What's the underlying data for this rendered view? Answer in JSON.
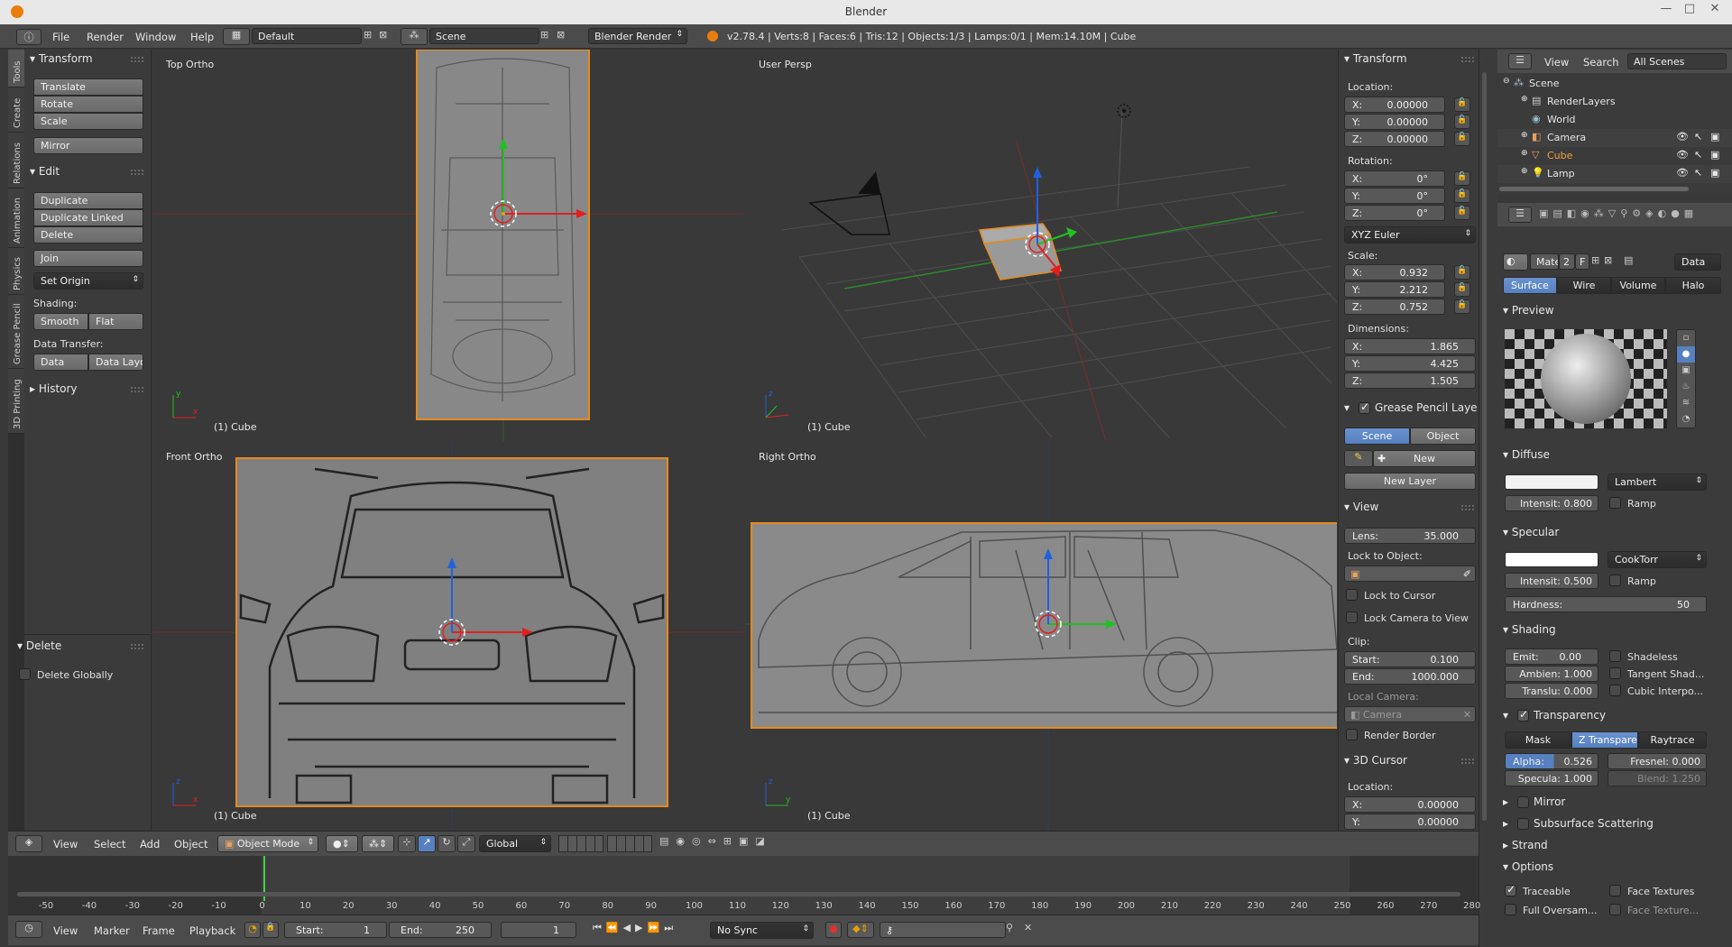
{
  "window": {
    "title": "Blender"
  },
  "info_bar": {
    "menus": [
      "File",
      "Render",
      "Window",
      "Help"
    ],
    "layout": "Default",
    "scene": "Scene",
    "engine": "Blender Render",
    "stats": "v2.78.4 | Verts:8 | Faces:6 | Tris:12 | Objects:1/3 | Lamps:0/1 | Mem:14.10M | Cube"
  },
  "tool_tabs": [
    "Tools",
    "Create",
    "Relations",
    "Animation",
    "Physics",
    "Grease Pencil",
    "3D Printing"
  ],
  "tool_shelf": {
    "transform_header": "Transform",
    "translate": "Translate",
    "rotate": "Rotate",
    "scale": "Scale",
    "mirror": "Mirror",
    "edit_header": "Edit",
    "duplicate": "Duplicate",
    "duplicate_linked": "Duplicate Linked",
    "delete": "Delete",
    "join": "Join",
    "set_origin": "Set Origin",
    "shading_label": "Shading:",
    "smooth": "Smooth",
    "flat": "Flat",
    "data_transfer_label": "Data Transfer:",
    "data": "Data",
    "data_layout": "Data Layo",
    "history_header": "History",
    "operator_header": "Delete",
    "delete_globally": "Delete Globally"
  },
  "viewports": {
    "top": {
      "label": "Top Ortho",
      "object": "(1) Cube"
    },
    "persp": {
      "label": "User Persp",
      "object": "(1) Cube"
    },
    "front": {
      "label": "Front Ortho",
      "object": "(1) Cube"
    },
    "right": {
      "label": "Right Ortho",
      "object": "(1) Cube"
    }
  },
  "npanel": {
    "transform_header": "Transform",
    "location_label": "Location:",
    "loc_x": "0.00000",
    "loc_y": "0.00000",
    "loc_z": "0.00000",
    "rotation_label": "Rotation:",
    "rot_x": "0°",
    "rot_y": "0°",
    "rot_z": "0°",
    "rotation_mode": "XYZ Euler",
    "scale_label": "Scale:",
    "scale_x": "0.932",
    "scale_y": "2.212",
    "scale_z": "0.752",
    "dimensions_label": "Dimensions:",
    "dim_x": "1.865",
    "dim_y": "4.425",
    "dim_z": "1.505",
    "gp_header": "Grease Pencil Layers",
    "gp_scene": "Scene",
    "gp_object": "Object",
    "gp_new": "New",
    "gp_new_layer": "New Layer",
    "view_header": "View",
    "lens_label": "Lens:",
    "lens": "35.000",
    "lock_to_object": "Lock to Object:",
    "lock_to_cursor": "Lock to Cursor",
    "lock_camera": "Lock Camera to View",
    "clip_label": "Clip:",
    "clip_start_label": "Start:",
    "clip_start": "0.100",
    "clip_end_label": "End:",
    "clip_end": "1000.000",
    "local_camera": "Local Camera:",
    "camera": "Camera",
    "render_border": "Render Border",
    "cursor_header": "3D Cursor",
    "cursor_location": "Location:",
    "cursor_x": "0.00000",
    "cursor_y": "0.00000",
    "axis_x": "X:",
    "axis_y": "Y:",
    "axis_z": "Z:"
  },
  "outliner": {
    "view": "View",
    "search": "Search",
    "filter": "All Scenes",
    "items": [
      "Scene",
      "RenderLayers",
      "World",
      "Camera",
      "Cube",
      "Lamp"
    ]
  },
  "properties": {
    "material_slot": "Mate",
    "users": "2",
    "fake": "F",
    "data": "Data",
    "tabs": [
      "Surface",
      "Wire",
      "Volume",
      "Halo"
    ],
    "preview_header": "Preview",
    "diffuse_header": "Diffuse",
    "diffuse_shader": "Lambert",
    "diffuse_intensity": "Intensit: 0.800",
    "ramp": "Ramp",
    "specular_header": "Specular",
    "specular_shader": "CookTorr",
    "specular_intensity": "Intensit: 0.500",
    "hardness": "Hardness:",
    "hardness_value": "50",
    "shading_header": "Shading",
    "emit": "Emit:",
    "emit_value": "0.00",
    "ambient": "Ambien: 1.000",
    "translucency": "Translu: 0.000",
    "shadeless": "Shadeless",
    "tangent": "Tangent Shad...",
    "cubic": "Cubic Interpo...",
    "transparency_header": "Transparency",
    "mask": "Mask",
    "ztransp": "Z Transpare...",
    "raytrace": "Raytrace",
    "alpha_label": "Alpha:",
    "alpha": "0.526",
    "fresnel": "Fresnel: 0.000",
    "specular_alpha": "Specula: 1.000",
    "blend": "Blend:  1.250",
    "mirror_header": "Mirror",
    "sss_header": "Subsurface Scattering",
    "strand_header": "Strand",
    "options_header": "Options",
    "traceable": "Traceable",
    "face_textures": "Face Textures",
    "full_oversampling": "Full Oversam...",
    "face_texture_alpha": "Face Texture..."
  },
  "view3d_header": {
    "menus": [
      "View",
      "Select",
      "Add",
      "Object"
    ],
    "mode": "Object Mode",
    "orientation": "Global"
  },
  "timeline": {
    "ticks": [
      "-50",
      "-40",
      "-30",
      "-20",
      "-10",
      "0",
      "10",
      "20",
      "30",
      "40",
      "50",
      "60",
      "70",
      "80",
      "90",
      "100",
      "110",
      "120",
      "130",
      "140",
      "150",
      "160",
      "170",
      "180",
      "190",
      "200",
      "210",
      "220",
      "230",
      "240",
      "250",
      "260",
      "270",
      "280"
    ],
    "menus": [
      "View",
      "Marker",
      "Frame",
      "Playback"
    ],
    "start_label": "Start:",
    "start": "1",
    "end_label": "End:",
    "end": "250",
    "current": "1",
    "sync": "No Sync"
  }
}
